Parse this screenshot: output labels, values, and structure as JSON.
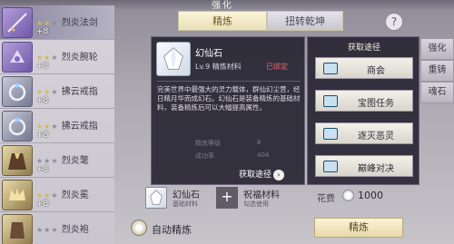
{
  "title": "强化",
  "tabs": [
    {
      "label": "精炼",
      "active": true
    },
    {
      "label": "扭转乾坤",
      "active": false
    }
  ],
  "help_label": "?",
  "equipment": [
    {
      "stars": 2,
      "max_stars": 3,
      "name": "烈炎法剑",
      "plus": "+8"
    },
    {
      "stars": 2,
      "max_stars": 3,
      "name": "烈炎腕轮",
      "plus": "+8"
    },
    {
      "stars": 2,
      "max_stars": 3,
      "name": "拂云戒指",
      "plus": "+8"
    },
    {
      "stars": 2,
      "max_stars": 3,
      "name": "拂云戒指",
      "plus": "+8"
    },
    {
      "stars": 0,
      "max_stars": 3,
      "name": "烈炎氅",
      "plus": "+8"
    },
    {
      "stars": 2,
      "max_stars": 3,
      "name": "烈炎冕",
      "plus": "+8"
    },
    {
      "stars": 0,
      "max_stars": 3,
      "name": "烈炎袍",
      "plus": ""
    }
  ],
  "item_card": {
    "name": "幻仙石",
    "level_type": "Lv.9 精炼材料",
    "bound": "已绑定",
    "description": "完美世界中最强大的灵力载体，群仙幻尘营，经日精月华而成幻石。幻仙石是装备精炼的基础材料，装备精炼后可以大幅提高属性。",
    "stats": [
      {
        "label": "精炼等级",
        "value": "8"
      },
      {
        "label": "成功率",
        "value": "404"
      }
    ],
    "get_label": "获取途径"
  },
  "acquisition": {
    "title": "获取途径",
    "items": [
      "商会",
      "宝图任务",
      "逐灭恶灵",
      "巅峰对决"
    ]
  },
  "side_buttons": [
    "强化",
    "重铸",
    "魂石"
  ],
  "materials": [
    {
      "name": "幻仙石",
      "sub": "基础材料"
    },
    {
      "name": "祝福材料",
      "sub": "勾选使用"
    }
  ],
  "plus_symbol": "+",
  "cost": {
    "label": "花费",
    "value": "1000"
  },
  "auto_refine_label": "自动精炼",
  "refine_button": "精炼"
}
